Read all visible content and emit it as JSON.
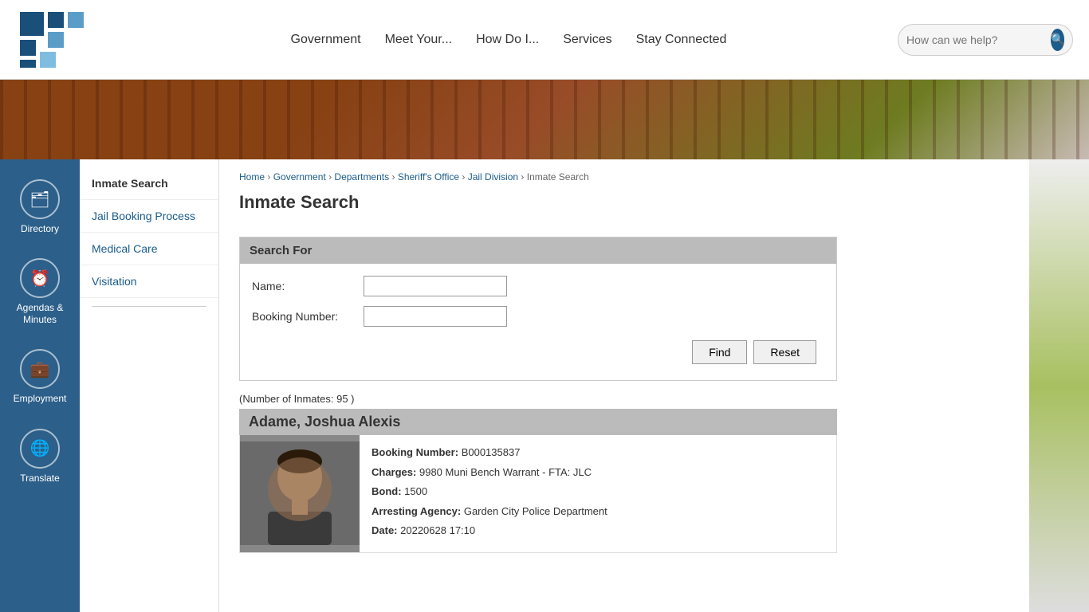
{
  "header": {
    "search_placeholder": "How can we help?",
    "nav": [
      {
        "label": "Government",
        "id": "government"
      },
      {
        "label": "Meet Your...",
        "id": "meet-your"
      },
      {
        "label": "How Do I...",
        "id": "how-do-i"
      },
      {
        "label": "Services",
        "id": "services"
      },
      {
        "label": "Stay Connected",
        "id": "stay-connected"
      }
    ]
  },
  "sidebar_left": {
    "items": [
      {
        "icon": "🗂",
        "label": "Directory",
        "id": "directory"
      },
      {
        "icon": "📅",
        "label": "Agendas &\nMinutes",
        "id": "agendas-minutes"
      },
      {
        "icon": "💼",
        "label": "Employment",
        "id": "employment"
      },
      {
        "icon": "🌐",
        "label": "Translate",
        "id": "translate"
      }
    ]
  },
  "sub_nav": {
    "items": [
      {
        "label": "Inmate Search",
        "active": true
      },
      {
        "label": "Jail Booking Process",
        "active": false
      },
      {
        "label": "Medical Care",
        "active": false
      },
      {
        "label": "Visitation",
        "active": false
      }
    ]
  },
  "breadcrumb": {
    "parts": [
      "Home",
      "Government",
      "Departments",
      "Sheriff's Office",
      "Jail Division",
      "Inmate Search"
    ]
  },
  "page": {
    "title": "Inmate Search"
  },
  "search_form": {
    "header": "Search For",
    "name_label": "Name:",
    "booking_label": "Booking Number:",
    "find_btn": "Find",
    "reset_btn": "Reset"
  },
  "results": {
    "inmate_count": "(Number of Inmates: 95 )",
    "inmate_name": "Adame, Joshua Alexis",
    "booking_number_label": "Booking Number:",
    "booking_number_value": "B000135837",
    "charges_label": "Charges:",
    "charges_value": "9980 Muni Bench Warrant - FTA: JLC",
    "bond_label": "Bond:",
    "bond_value": "1500",
    "arresting_label": "Arresting Agency:",
    "arresting_value": "Garden City Police Department",
    "date_label": "Date:",
    "date_value": "20220628 17:10"
  }
}
